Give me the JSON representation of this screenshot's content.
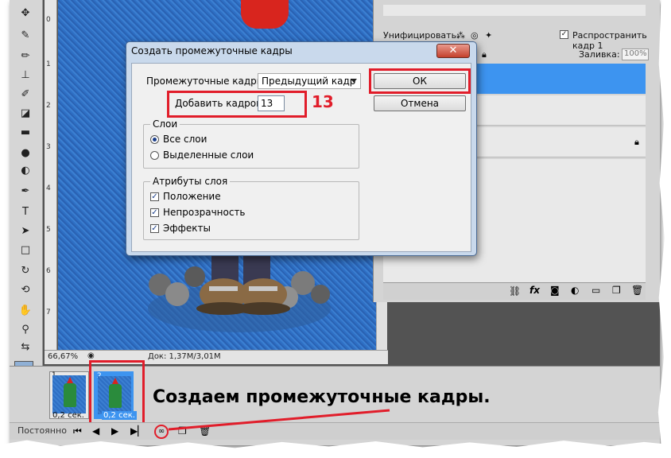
{
  "dialog": {
    "title": "Создать промежуточные кадры",
    "close_icon": "close-x-icon",
    "tween_with_label": "Промежуточные кадры:",
    "tween_with_value": "Предыдущий кадр",
    "frames_to_add_label": "Добавить кадров:",
    "frames_to_add_value": "13",
    "layers_group_title": "Слои",
    "all_layers_label": "Все слои",
    "selected_layers_label": "Выделенные слои",
    "params_group_title": "Атрибуты слоя",
    "position_label": "Положение",
    "opacity_label": "Непрозрачность",
    "effects_label": "Эффекты",
    "ok_label": "ОК",
    "cancel_label": "Отмена"
  },
  "annotation": {
    "number": "13",
    "caption": "Создаем промежуточные кадры.",
    "color": "#e11d2a"
  },
  "layers_panel": {
    "unify_label": "Унифицировать:",
    "propagate_label": "Распространить кадр 1",
    "fill_label": "Заливка:",
    "fill_value": "100%"
  },
  "status": {
    "zoom": "66,67%",
    "doc_size": "Док: 1,37M/3,01M"
  },
  "animation": {
    "frames": [
      {
        "number": "1",
        "delay": "0,2 сек."
      },
      {
        "number": "2",
        "delay": "0,2 сек."
      }
    ],
    "loop_label": "Постоянно"
  },
  "ruler_numbers": [
    "0",
    "1",
    "2",
    "3",
    "4",
    "5",
    "6",
    "7"
  ],
  "colors": {
    "selection": "#3d94f0",
    "dialog_frame": "#c9d9ec",
    "canvas_blue": "#2e6fc4"
  }
}
